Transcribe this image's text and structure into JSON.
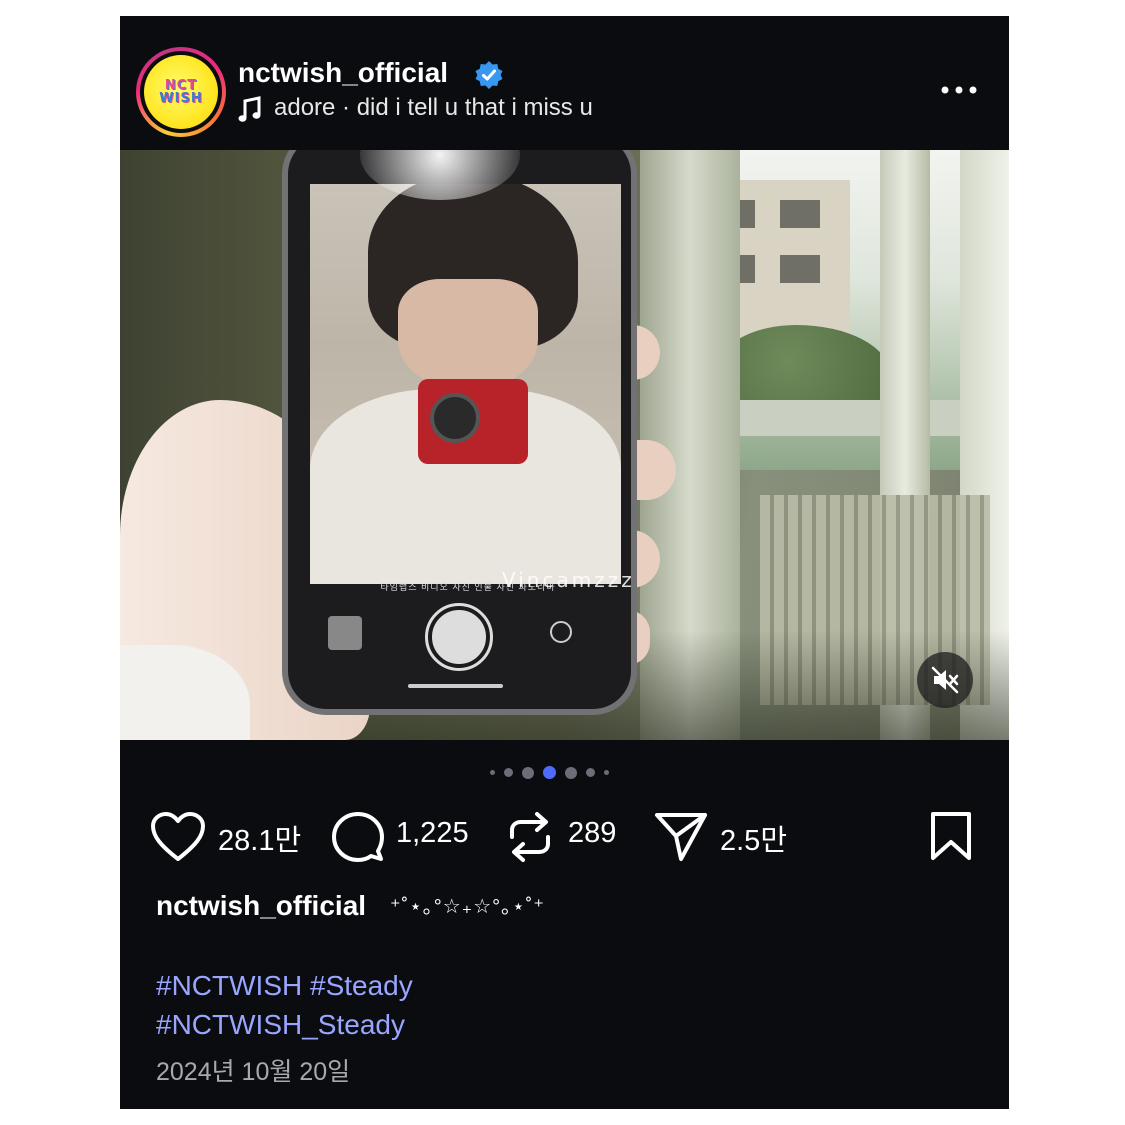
{
  "post": {
    "username": "nctwish_official",
    "avatar_text_line1": "NCT",
    "avatar_text_line2": "WISH",
    "music": "adore · did i tell u that i miss u",
    "watermark": "Vincamzzz",
    "camera_modes": "타임랩스   비디오   사진   인물 사진   파노라마",
    "carousel": {
      "total": 7,
      "active_index": 3
    },
    "actions": {
      "likes": "28.1만",
      "comments": "1,225",
      "reposts": "289",
      "shares": "2.5만"
    },
    "caption_user": "nctwish_official",
    "caption_deco": "⁺˚⋆｡°☆₊☆°｡⋆˚⁺",
    "hashtags": [
      "#NCTWISH #Steady",
      "#NCTWISH_Steady"
    ],
    "date": "2024년 10월 20일"
  },
  "colors": {
    "background": "#0b0c10",
    "hashtag": "#9aa5ff",
    "verified": "#3897f0",
    "active_dot": "#4f6bff"
  },
  "icons": [
    "verified-badge-icon",
    "music-note-icon",
    "more-options-icon",
    "mute-icon",
    "heart-icon",
    "comment-icon",
    "repost-icon",
    "share-icon",
    "bookmark-icon"
  ]
}
